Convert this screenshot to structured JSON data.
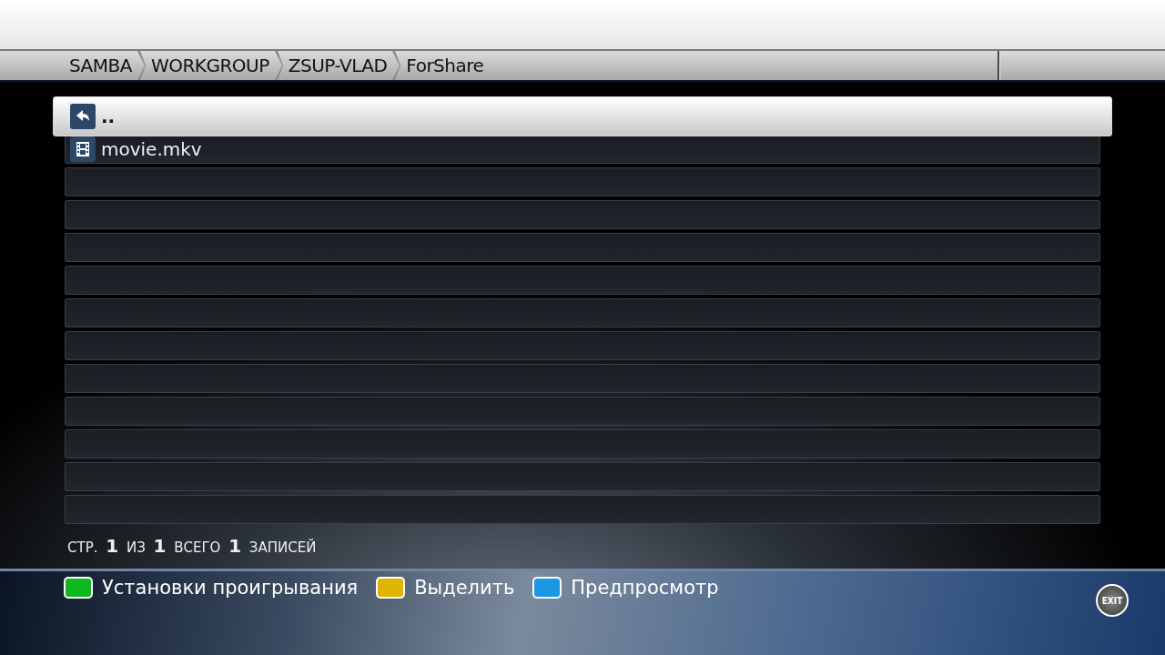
{
  "breadcrumb": [
    "SAMBA",
    "WORKGROUP",
    "ZSUP-VLAD",
    "ForShare"
  ],
  "files": [
    {
      "name": "..",
      "kind": "up",
      "selected": true
    },
    {
      "name": "movie.mkv",
      "kind": "video",
      "selected": false
    }
  ],
  "page_info": "СТР. **1** ИЗ **1** ВСЕГО **1** ЗАПИСЕЙ",
  "actions": [
    {
      "label": "Установки проигрывания",
      "color": "#10b820"
    },
    {
      "label": "Выделить",
      "color": "#e0b400"
    },
    {
      "label": "Предпросмотр",
      "color": "#1a98e0"
    }
  ],
  "exit_button": "EXIT"
}
